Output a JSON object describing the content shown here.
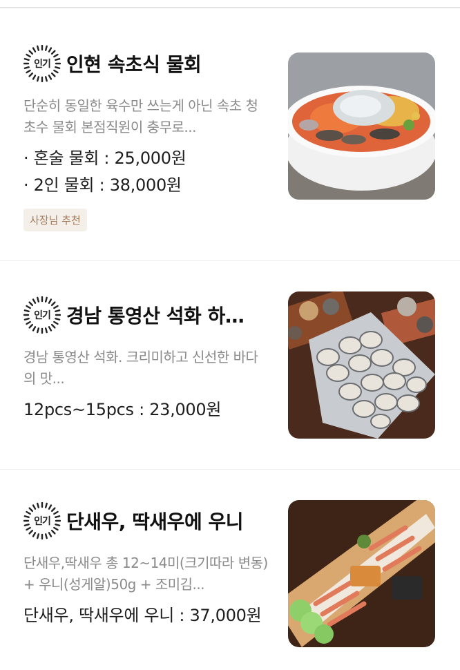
{
  "menu": [
    {
      "badge": "인기",
      "title": "인현 속초식 물회",
      "description": "단순히 동일한 육수만 쓰는게 아닌 속초 청초수 물회 본점직원이 충무로...",
      "prices": [
        "· 혼술 물회 : 25,000원",
        "· 2인 물회 : 38,000원"
      ],
      "tag": "사장님 추천",
      "image": "mulhoe-bowl"
    },
    {
      "badge": "인기",
      "title": "경남 통영산 석화 하…",
      "description": "경남 통영산 석화. 크리미하고 신선한 바다의 맛...",
      "prices": [
        "12pcs~15pcs : 23,000원"
      ],
      "image": "oyster-platter"
    },
    {
      "badge": "인기",
      "title": "단새우, 딱새우에 우니",
      "description": "단새우,딱새우 총 12~14미(크기따라 변동)  + 우니(성게알)50g + 조미김...",
      "prices": [
        "단새우, 딱새우에 우니 : 37,000원"
      ],
      "image": "shrimp-uni-board"
    }
  ],
  "colors": {
    "tag_bg": "#f4efe9",
    "tag_text": "#a27b5c",
    "description": "#8a8a8a",
    "divider": "#eeeeee"
  }
}
